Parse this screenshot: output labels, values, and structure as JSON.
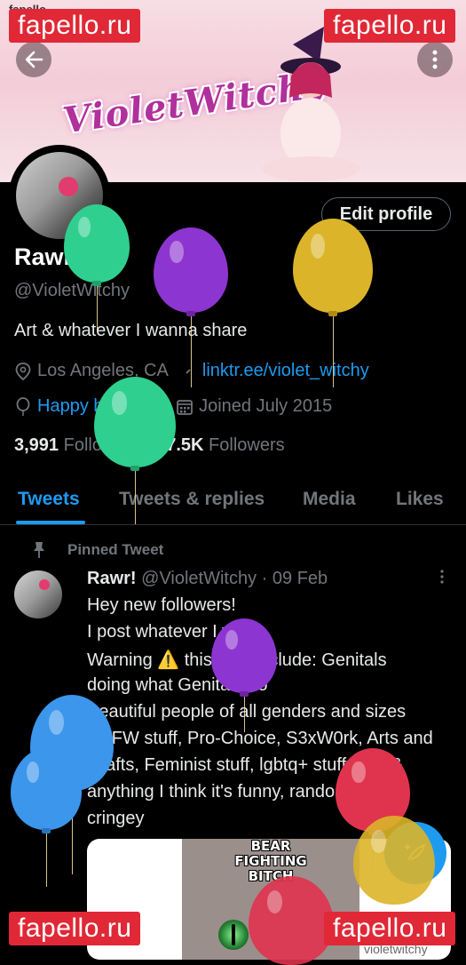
{
  "status_bar": {
    "left_text": "fapello",
    "right_text": ""
  },
  "banner": {
    "title": "VioletWitchy"
  },
  "header": {
    "back_icon": "arrow-left-icon",
    "more_icon": "more-vertical-icon"
  },
  "profile": {
    "edit_label": "Edit profile",
    "name": "Rawr!",
    "handle": "@VioletWitchy",
    "bio": "Art & whatever I wanna share",
    "location": "Los Angeles, CA",
    "link": "linktr.ee/violet_witchy",
    "birthday": "Happy birthday!",
    "joined": "Joined July 2015",
    "following_count": "3,991",
    "following_label": "Following",
    "followers_count": "17.5K",
    "followers_label": "Followers"
  },
  "tabs": [
    {
      "label": "Tweets",
      "active": true
    },
    {
      "label": "Tweets & replies",
      "active": false
    },
    {
      "label": "Media",
      "active": false
    },
    {
      "label": "Likes",
      "active": false
    }
  ],
  "tweet": {
    "pinned_label": "Pinned Tweet",
    "author": "Rawr!",
    "handle_time": "@VioletWitchy · 09 Feb",
    "lines": [
      "Hey new followers!",
      "I post whatever I want",
      "Warning ⚠️ this may include: Genitals",
      "doing what Genitals do",
      "Beautiful people of all genders and sizes",
      "NSFW stuff, Pro-Choice, S3xW0rk, Arts and",
      "Crafts, Feminist stuff, lgbtq+ stuff, +18 &",
      "anything I think it's funny, random, or",
      "cringey"
    ],
    "media_text": "BEAR FIGHTING BITCH"
  },
  "watermarks": [
    "fapello.ru",
    "fapello.ru",
    "fapello.ru",
    "fapello.ru"
  ],
  "corner_text": "violetwitchy",
  "colors": {
    "accent": "#1d9bf0",
    "background": "#000000",
    "watermark": "#e02836"
  }
}
